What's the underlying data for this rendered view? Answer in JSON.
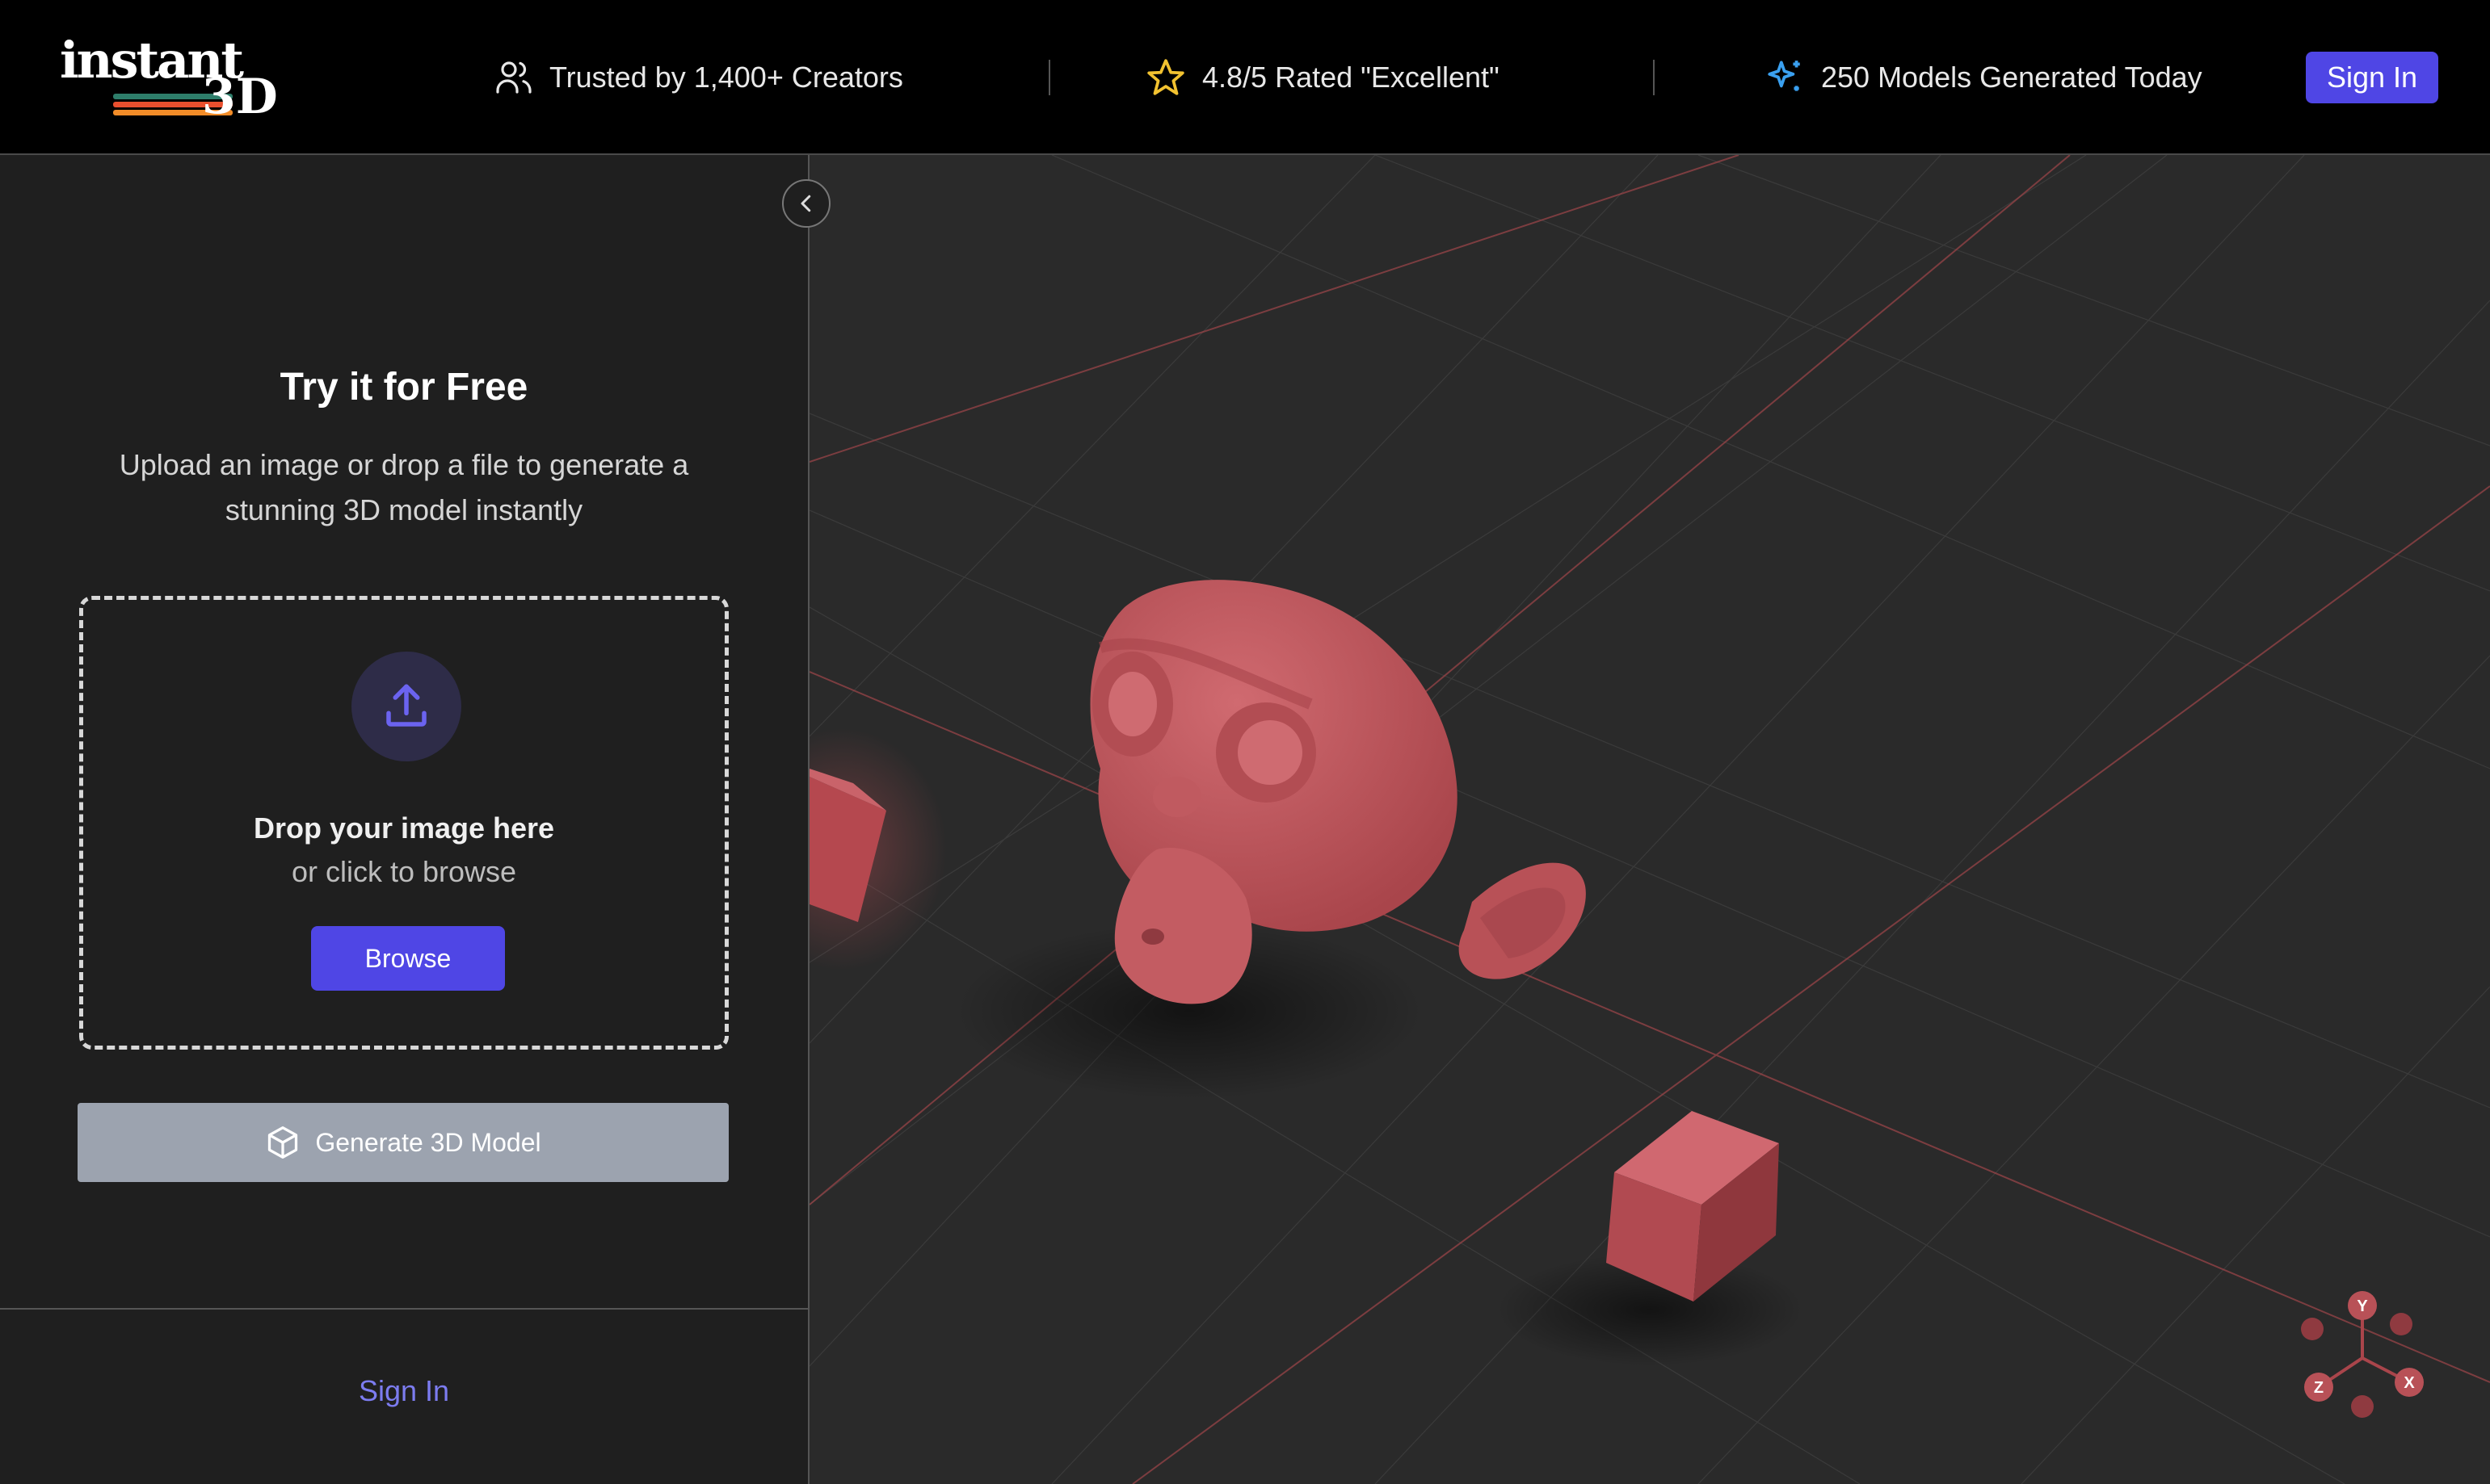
{
  "header": {
    "logo": {
      "word": "instant",
      "mark": "3D",
      "stripe_colors": [
        "#2e7d6a",
        "#e94f2e",
        "#f28c28"
      ]
    },
    "stats": [
      {
        "icon": "users-icon",
        "text": "Trusted by 1,400+ Creators"
      },
      {
        "icon": "star-icon",
        "text": "4.8/5 Rated \"Excellent\"",
        "icon_color": "#f2c230"
      },
      {
        "icon": "sparkles-icon",
        "text": "250 Models Generated Today",
        "icon_color": "#3aa0f0"
      }
    ],
    "sign_in_label": "Sign In"
  },
  "sidebar": {
    "collapse_icon": "chevron-left-icon",
    "title": "Try it for Free",
    "subtitle": "Upload an image or drop a file to generate a stunning 3D model instantly",
    "dropzone": {
      "icon": "upload-icon",
      "title": "Drop your image here",
      "subtitle": "or click to browse",
      "browse_label": "Browse"
    },
    "generate_label": "Generate 3D Model",
    "generate_icon": "cube-icon",
    "sign_in_link": "Sign In"
  },
  "viewport": {
    "object_color": "#b94f55",
    "grid_color": "#a0464a",
    "axis_gizmo": {
      "labels": [
        "Y",
        "X",
        "Z"
      ]
    }
  },
  "colors": {
    "accent": "#4f46e5",
    "header_bg": "#000000",
    "sidebar_bg": "#1f1f1f",
    "viewport_bg": "#2a2a2a"
  }
}
